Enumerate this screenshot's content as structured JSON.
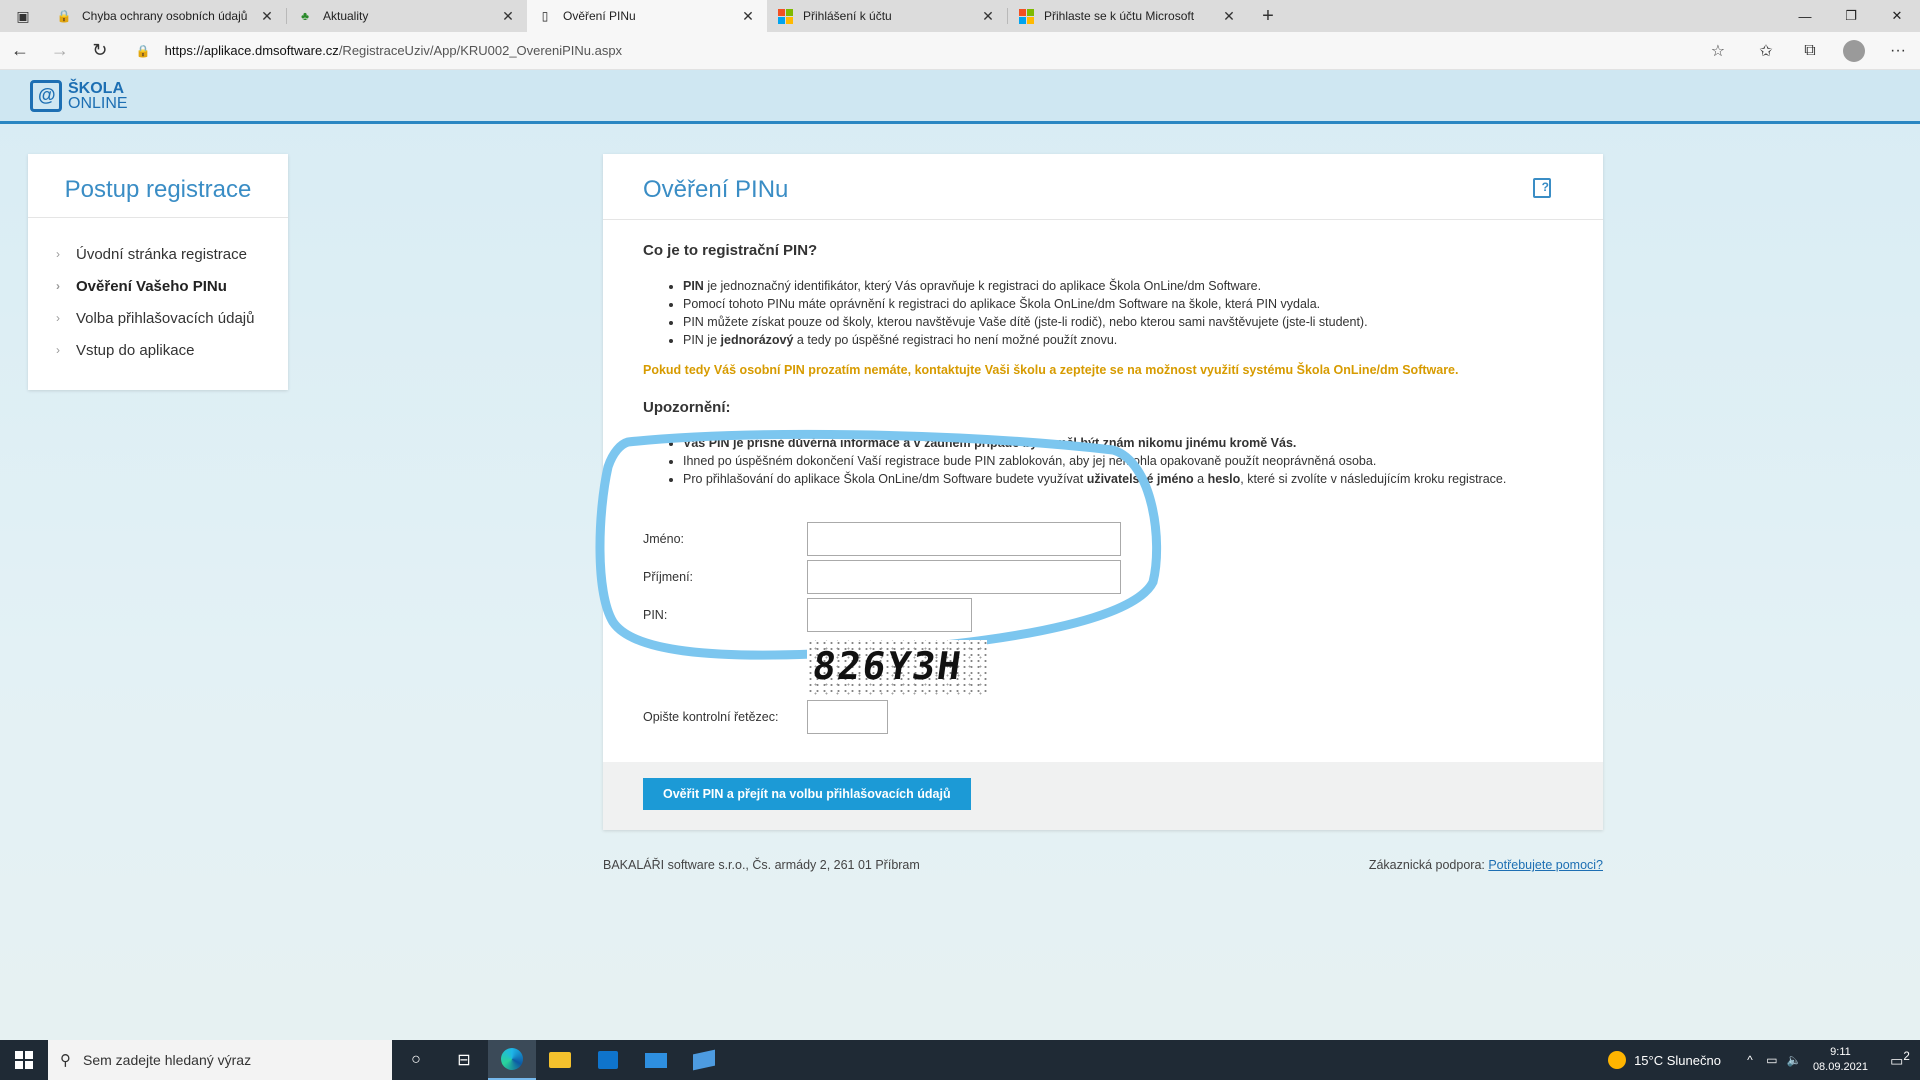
{
  "browser": {
    "tabs": [
      {
        "title": "Chyba ochrany osobních údajů",
        "icon": "privacy-error-icon",
        "active": false
      },
      {
        "title": "Aktuality",
        "icon": "tree-icon",
        "active": false
      },
      {
        "title": "Ověření PINu",
        "icon": "page-icon",
        "active": true
      },
      {
        "title": "Přihlášení k účtu",
        "icon": "microsoft-icon",
        "active": false
      },
      {
        "title": "Přihlaste se k účtu Microsoft",
        "icon": "microsoft-icon",
        "active": false
      }
    ],
    "url_host": "https://aplikace.dmsoftware.cz",
    "url_path": "/RegistraceUziv/App/KRU002_OvereniPINu.aspx"
  },
  "logo": {
    "line1": "ŠKOLA",
    "line2": "ONLINE"
  },
  "sidebar": {
    "title": "Postup registrace",
    "items": [
      {
        "label": "Úvodní stránka registrace"
      },
      {
        "label": "Ověření Vašeho PINu"
      },
      {
        "label": "Volba přihlašovacích údajů"
      },
      {
        "label": "Vstup do aplikace"
      }
    ]
  },
  "main": {
    "title": "Ověření PINu",
    "what_heading": "Co je to registrační PIN?",
    "what_bullets": [
      {
        "bold": "PIN",
        "text": " je jednoznačný identifikátor, který Vás opravňuje k registraci do aplikace Škola OnLine/dm Software."
      },
      {
        "bold": "",
        "text": "Pomocí tohoto PINu máte oprávnění k registraci do aplikace Škola OnLine/dm Software na škole, která PIN vydala."
      },
      {
        "bold": "",
        "text": "PIN můžete získat pouze od školy, kterou navštěvuje Vaše dítě (jste-li rodič), nebo kterou sami navštěvujete (jste-li student)."
      },
      {
        "pre": "PIN je ",
        "bold": "jednorázový",
        "text": " a tedy po úspěšné registraci ho není možné použít znovu."
      }
    ],
    "notice": "Pokud tedy Váš osobní PIN prozatím nemáte, kontaktujte Vaši školu a zeptejte se na možnost využití systému Škola OnLine/dm Software.",
    "warn_heading": "Upozornění:",
    "warn_bullets": [
      {
        "bold": "Váš PIN je přísně důvěrná informace a v žádném případě by neměl být znám nikomu jinému kromě Vás."
      },
      {
        "text": "Ihned po úspěšném dokončení Vaší registrace bude PIN zablokován, aby jej nemohla opakovaně použít neoprávněná osoba."
      },
      {
        "pre": "Pro přihlašování do aplikace Škola OnLine/dm Software budete využívat ",
        "bold1": "uživatelské jméno",
        "mid": " a ",
        "bold2": "heslo",
        "text": ", které si zvolíte v následujícím kroku registrace."
      }
    ],
    "form": {
      "first_name_label": "Jméno:",
      "first_name_value": "",
      "last_name_label": "Příjmení:",
      "last_name_value": "",
      "pin_label": "PIN:",
      "pin_value": "",
      "captcha_text": "826Y3H",
      "captcha_label": "Opište kontrolní řetězec:",
      "captcha_value": ""
    },
    "submit_label": "Ověřit PIN a přejít na volbu přihlašovacích údajů"
  },
  "footer": {
    "company": "BAKALÁŘI software s.r.o., Čs. armády 2, 261 01 Příbram",
    "support_label": "Zákaznická podpora: ",
    "support_link": "Potřebujete pomoci?"
  },
  "taskbar": {
    "search_placeholder": "Sem zadejte hledaný výraz",
    "weather": "15°C  Slunečno",
    "time": "9:11",
    "date": "08.09.2021",
    "notifications": "2"
  },
  "colors": {
    "accent": "#3a8dc5",
    "button": "#1c9ad6",
    "notice": "#d79b00",
    "highlight_outline": "#7cc6ef"
  }
}
